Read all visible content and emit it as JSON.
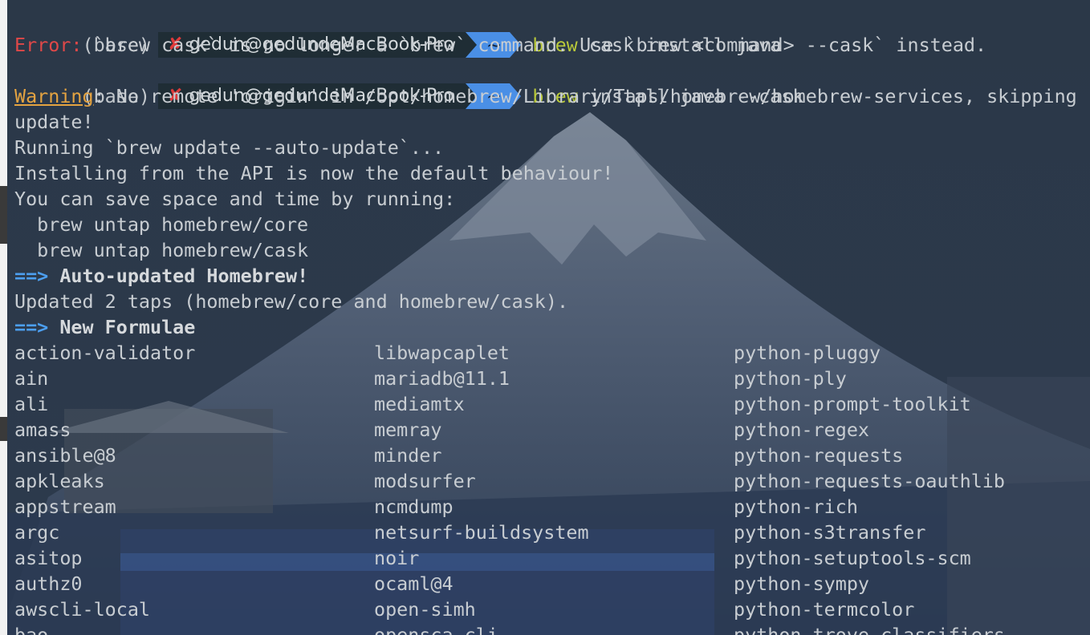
{
  "prompt": {
    "env": "(base)",
    "status_mark": "✘",
    "host": "gedun@gedundeMacBook-Pro",
    "dir": "~"
  },
  "commands": [
    {
      "bin": "brew",
      "args": "cask install java"
    },
    {
      "bin": "brew",
      "args": "install java --cask"
    }
  ],
  "error": {
    "label": "Error:",
    "text": " `brew cask` is no longer a `brew` command. Use `brew <command> --cask` instead."
  },
  "warning": {
    "label": "Warning",
    "text": ": No remote 'origin' in /opt/homebrew/Library/Taps/homebrew/homebrew-services, skipping",
    "cont": "update!"
  },
  "output": {
    "running": "Running `brew update --auto-update`...",
    "api": "Installing from the API is now the default behaviour!",
    "save": "You can save space and time by running:",
    "untap_core": "  brew untap homebrew/core",
    "untap_cask": "  brew untap homebrew/cask",
    "arrow": "==>",
    "auto_updated": "Auto-updated Homebrew!",
    "updated_taps": "Updated 2 taps (homebrew/core and homebrew/cask).",
    "new_formulae": "New Formulae"
  },
  "formulae": {
    "col1": [
      "action-validator",
      "ain",
      "ali",
      "amass",
      "ansible@8",
      "apkleaks",
      "appstream",
      "argc",
      "asitop",
      "authz0",
      "awscli-local",
      "bao"
    ],
    "col2": [
      "libwapcaplet",
      "mariadb@11.1",
      "mediamtx",
      "memray",
      "minder",
      "modsurfer",
      "ncmdump",
      "netsurf-buildsystem",
      "noir",
      "ocaml@4",
      "open-simh",
      "opensca-cli"
    ],
    "col3": [
      "python-pluggy",
      "python-ply",
      "python-prompt-toolkit",
      "python-regex",
      "python-requests",
      "python-requests-oauthlib",
      "python-rich",
      "python-s3transfer",
      "python-setuptools-scm",
      "python-sympy",
      "python-termcolor",
      "python-trove-classifiers"
    ]
  },
  "colors": {
    "background": "#2a3443",
    "prompt_host_bg": "#1f2d35",
    "prompt_dir_bg": "#4a8fe6",
    "command": "#b9c93a",
    "error": "#e04848",
    "warning": "#e4a341",
    "arrow": "#4c9ff0"
  }
}
